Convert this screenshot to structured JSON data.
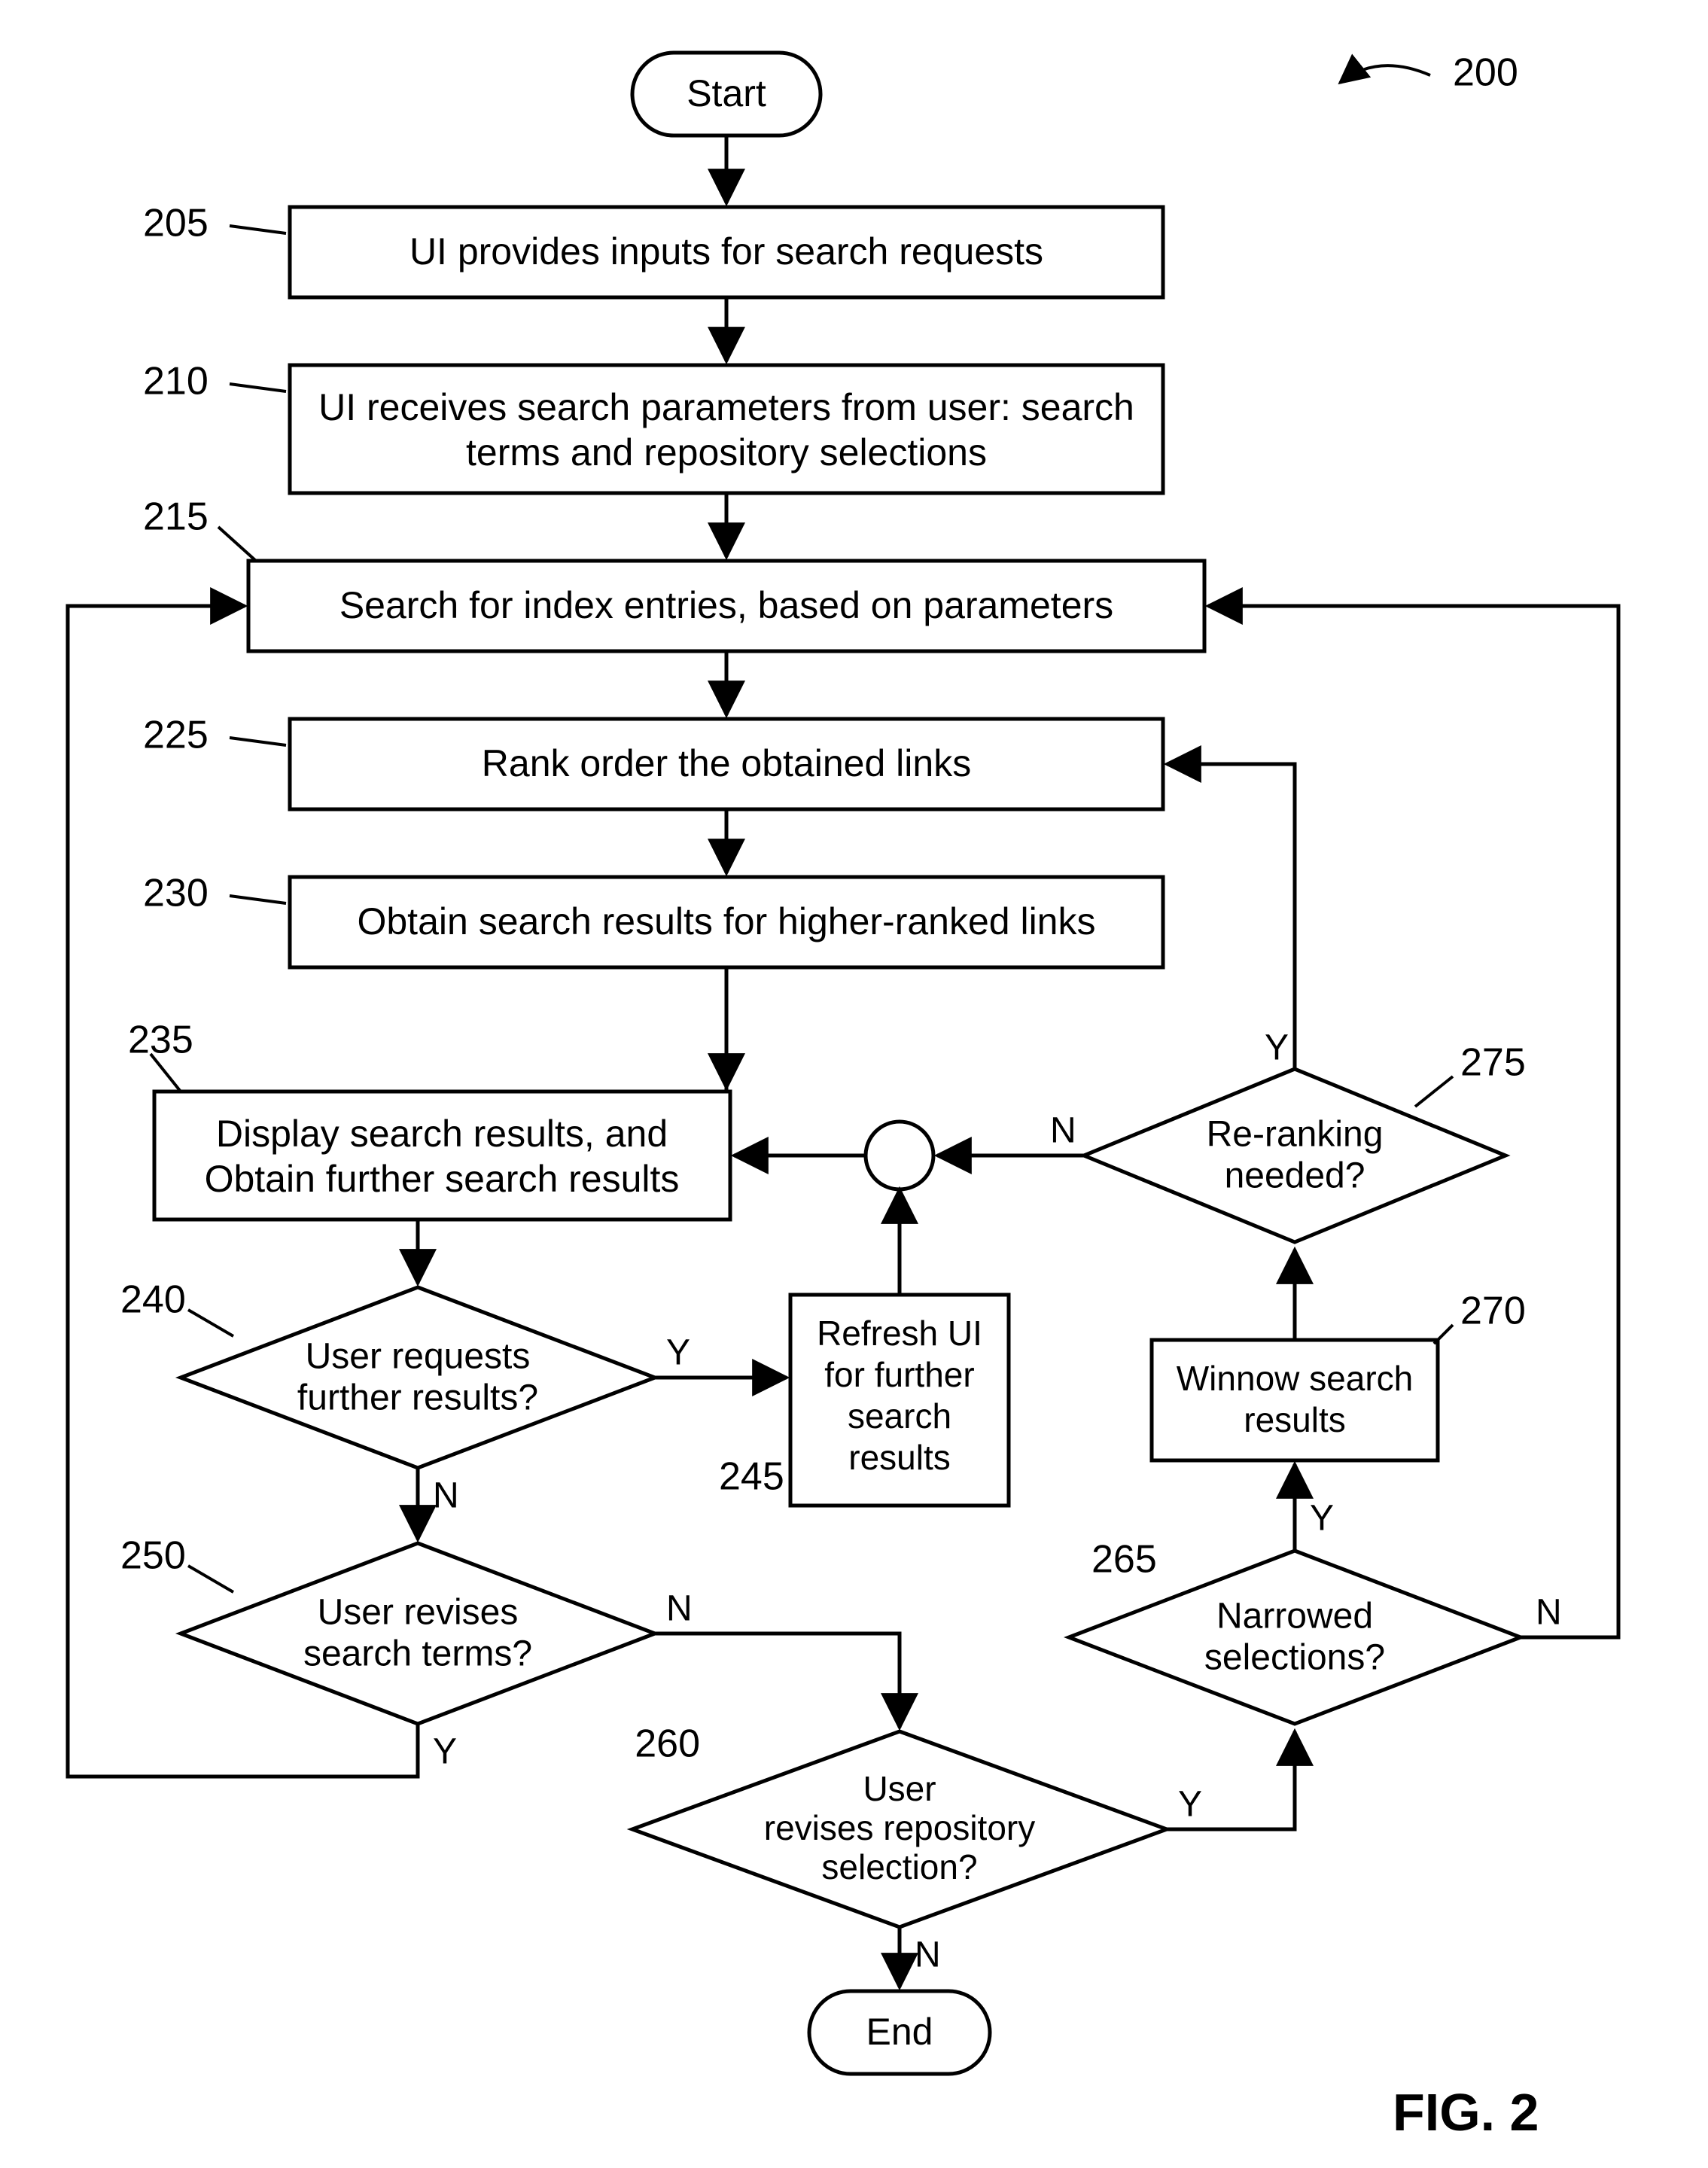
{
  "figure": {
    "caption": "FIG. 2",
    "ref": "200"
  },
  "nodes": {
    "start": {
      "label": "Start"
    },
    "n205": {
      "ref": "205",
      "text": "UI provides inputs for search requests"
    },
    "n210": {
      "ref": "210",
      "text1": "UI receives search parameters from user: search",
      "text2": "terms and repository selections"
    },
    "n215": {
      "ref": "215",
      "text": "Search for index entries, based on parameters"
    },
    "n225": {
      "ref": "225",
      "text": "Rank order the obtained links"
    },
    "n230": {
      "ref": "230",
      "text": "Obtain search results for higher-ranked links"
    },
    "n235": {
      "ref": "235",
      "text1": "Display search results, and",
      "text2": "Obtain further search results"
    },
    "n240": {
      "ref": "240",
      "text1": "User requests",
      "text2": "further results?"
    },
    "n245": {
      "ref": "245",
      "text1": "Refresh UI",
      "text2": "for further",
      "text3": "search",
      "text4": "results"
    },
    "n250": {
      "ref": "250",
      "text1": "User revises",
      "text2": "search terms?"
    },
    "n260": {
      "ref": "260",
      "text1": "User",
      "text2": "revises repository",
      "text3": "selection?"
    },
    "n265": {
      "ref": "265",
      "text1": "Narrowed",
      "text2": "selections?"
    },
    "n270": {
      "ref": "270",
      "text1": "Winnow search",
      "text2": "results"
    },
    "n275": {
      "ref": "275",
      "text1": "Re-ranking",
      "text2": "needed?"
    },
    "end": {
      "label": "End"
    }
  },
  "labels": {
    "Y": "Y",
    "N": "N"
  }
}
